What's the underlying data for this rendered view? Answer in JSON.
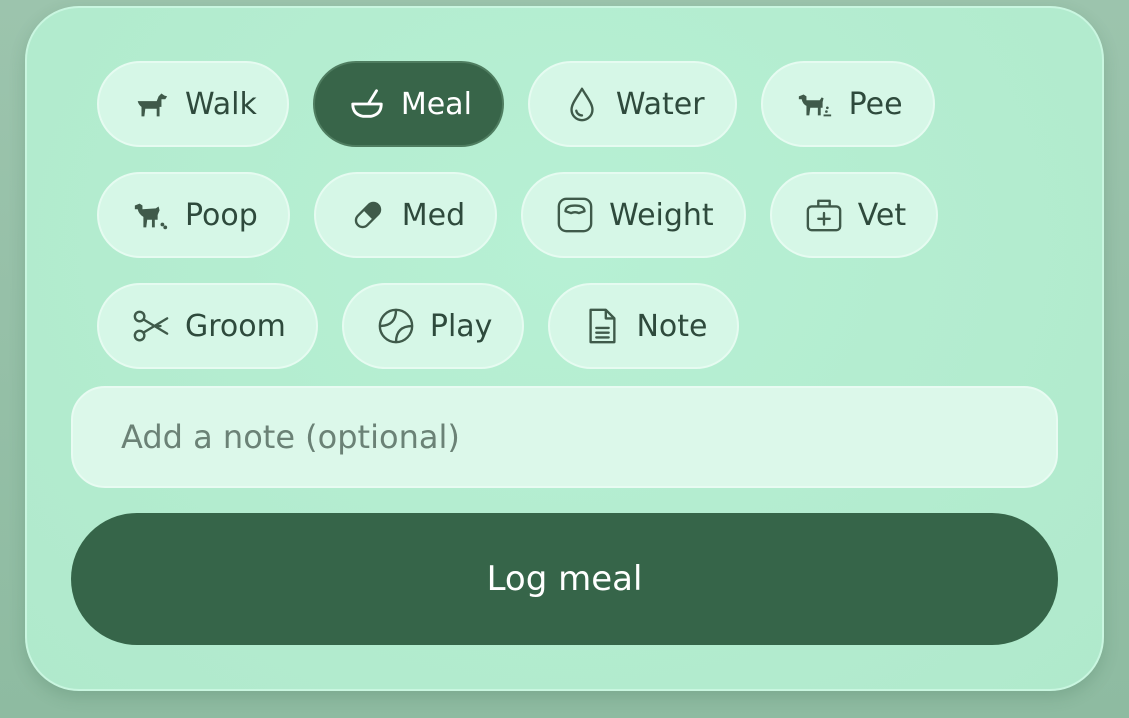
{
  "activities": {
    "row1": [
      {
        "label": "Walk",
        "icon": "dog-walk-icon",
        "selected": false
      },
      {
        "label": "Meal",
        "icon": "bowl-icon",
        "selected": true
      },
      {
        "label": "Water",
        "icon": "water-drop-icon",
        "selected": false
      },
      {
        "label": "Pee",
        "icon": "dog-pee-icon",
        "selected": false
      }
    ],
    "row2": [
      {
        "label": "Poop",
        "icon": "dog-poop-icon",
        "selected": false
      },
      {
        "label": "Med",
        "icon": "pill-icon",
        "selected": false
      },
      {
        "label": "Weight",
        "icon": "scale-icon",
        "selected": false
      },
      {
        "label": "Vet",
        "icon": "medical-kit-icon",
        "selected": false
      }
    ],
    "row3": [
      {
        "label": "Groom",
        "icon": "scissors-icon",
        "selected": false
      },
      {
        "label": "Play",
        "icon": "ball-icon",
        "selected": false
      },
      {
        "label": "Note",
        "icon": "document-icon",
        "selected": false
      }
    ]
  },
  "note": {
    "placeholder": "Add a note (optional)",
    "value": ""
  },
  "submit": {
    "label": "Log meal"
  },
  "colors": {
    "accent": "#366549",
    "card": "#b3eccf",
    "chip": "#d6f7e7",
    "text": "#2e4a3c",
    "background": "#8ebba1"
  }
}
